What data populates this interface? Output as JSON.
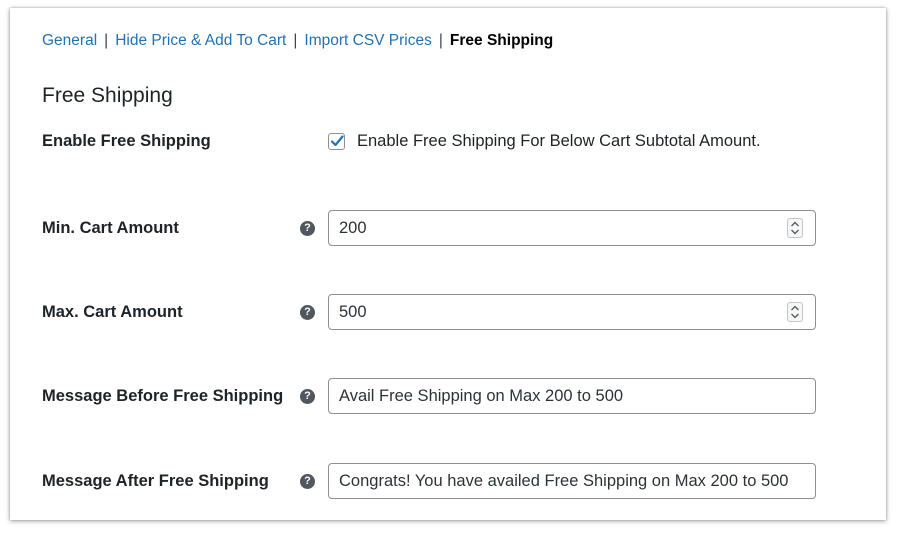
{
  "nav": {
    "tabs": [
      {
        "label": "General"
      },
      {
        "label": "Hide Price & Add To Cart"
      },
      {
        "label": "Import CSV Prices"
      },
      {
        "label": "Free Shipping"
      }
    ],
    "separator": "|"
  },
  "section": {
    "title": "Free Shipping"
  },
  "fields": {
    "enable": {
      "label": "Enable Free Shipping",
      "checkbox_label": "Enable Free Shipping For Below Cart Subtotal Amount.",
      "checked": true
    },
    "min_amount": {
      "label": "Min. Cart Amount",
      "value": "200"
    },
    "max_amount": {
      "label": "Max. Cart Amount",
      "value": "500"
    },
    "msg_before": {
      "label": "Message Before Free Shipping",
      "value": "Avail Free Shipping on Max 200 to 500"
    },
    "msg_after": {
      "label": "Message After Free Shipping",
      "value": "Congrats! You have availed Free Shipping on Max 200 to 500"
    }
  },
  "help_icon": {
    "glyph": "?"
  },
  "colors": {
    "link": "#2271b1",
    "checkmark": "#2271b1",
    "help_icon": "#50575e"
  }
}
